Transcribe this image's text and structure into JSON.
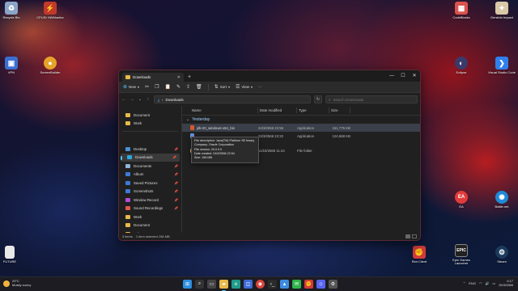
{
  "desktop": {
    "icons_left": [
      {
        "label": "Recycle Bin",
        "icon": "recycle-bin-icon",
        "color": "#8aa4c8"
      },
      {
        "label": "CPUID HWMonitor",
        "icon": "hwmonitor-icon",
        "color": "#c0392b"
      },
      {
        "label": "VPN",
        "icon": "vpn-icon",
        "color": "#3b6fd1"
      },
      {
        "label": "ScreenBuilder",
        "icon": "screenbuilder-icon",
        "color": "#e6a32a"
      },
      {
        "label": "FUTURE",
        "icon": "file-icon",
        "color": "#e8e8e8"
      }
    ],
    "icons_right": [
      {
        "label": "CodeBlocks",
        "icon": "codeblocks-icon",
        "color": "#d9534f"
      },
      {
        "label": "Genshin Impact",
        "icon": "genshin-icon",
        "color": "#d8c8a8"
      },
      {
        "label": "Eclipse",
        "icon": "eclipse-icon",
        "color": "#3a3a6a"
      },
      {
        "label": "Visual Studio Code",
        "icon": "vscode-icon",
        "color": "#2f80ed"
      },
      {
        "label": "EA",
        "icon": "ea-icon",
        "color": "#e23b3b"
      },
      {
        "label": "Battle.net",
        "icon": "battlenet-icon",
        "color": "#1f8ad6"
      },
      {
        "label": "Riot Client",
        "icon": "riot-client-icon",
        "color": "#d13b3b"
      },
      {
        "label": "Epic Games Launcher",
        "icon": "epic-games-icon",
        "color": "#222222"
      },
      {
        "label": "Steam",
        "icon": "steam-icon",
        "color": "#1b3a5c"
      }
    ]
  },
  "explorer": {
    "tab_title": "Downloads",
    "new_tab": "+",
    "commands": {
      "new": "New",
      "sort": "Sort",
      "view": "View",
      "more": "···"
    },
    "address": "Downloads",
    "search_placeholder": "Search Downloads",
    "nav": {
      "quick": [
        "Document",
        "Work"
      ],
      "pinned": [
        "Desktop",
        "Downloads",
        "Documents",
        "Album",
        "Saved Pictures",
        "Screenshots",
        "Window Record",
        "Sound Recordings",
        "Work",
        "Document",
        "eclipse"
      ]
    },
    "columns": {
      "name": "Name",
      "date": "Date modified",
      "type": "Type",
      "size": "Size"
    },
    "group_label": "Yesterday",
    "rows": [
      {
        "name": "jdk-20_windows-x64_bin",
        "date": "24/3/2566 22:56",
        "type": "Application",
        "size": "161,775 KB"
      },
      {
        "name": "",
        "date": "24/3/2566 22:22",
        "type": "Application",
        "size": "124,668 KB"
      },
      {
        "name": "",
        "date": "11/10/2565 11:44",
        "type": "File folder",
        "size": ""
      }
    ],
    "tooltip": [
      "File description: Java(TM) Platform SE binary",
      "Company: Oracle Corporation",
      "File version: 20.0.0.0",
      "Date created: 24/3/2566 22:54",
      "Size: 158 MB"
    ],
    "status": {
      "items": "3 items",
      "selected": "1 item selected  158 MB"
    }
  },
  "taskbar": {
    "weather_temp": "29°C",
    "weather_desc": "Mostly sunny",
    "lang": "ENG",
    "time": "0:17",
    "date": "25/3/2566"
  }
}
